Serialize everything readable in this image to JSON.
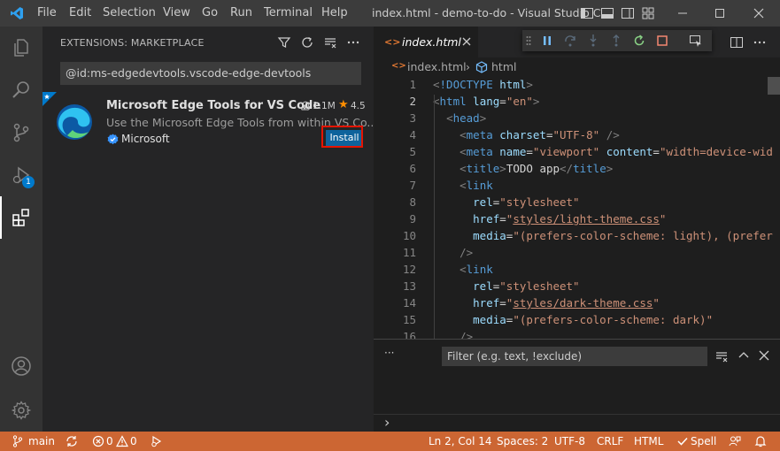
{
  "titlebar": {
    "menus": [
      "File",
      "Edit",
      "Selection",
      "View",
      "Go",
      "Run",
      "Terminal",
      "Help"
    ],
    "window_title": "index.html - demo-to-do - Visual Studio C..."
  },
  "activitybar": {
    "debug_badge": "1"
  },
  "sidebar": {
    "title": "EXTENSIONS: MARKETPLACE",
    "search_value": "@id:ms-edgedevtools.vscode-edge-devtools",
    "extension": {
      "name": "Microsoft Edge Tools for VS Code",
      "downloads": "1.1M",
      "rating": "4.5",
      "description": "Use the Microsoft Edge Tools from within VS Co...",
      "publisher": "Microsoft",
      "install_label": "Install"
    }
  },
  "editor": {
    "tab_label": "index.html",
    "breadcrumb": [
      "index.html",
      "html"
    ],
    "line_numbers": [
      "1",
      "2",
      "3",
      "4",
      "5",
      "6",
      "7",
      "8",
      "9",
      "10",
      "11",
      "12",
      "13",
      "14",
      "15",
      "16"
    ],
    "current_line": "2"
  },
  "panel": {
    "filter_placeholder": "Filter (e.g. text, !exclude)",
    "more_label": "···",
    "prompt": "›"
  },
  "statusbar": {
    "branch": "main",
    "errors": "0",
    "warnings": "0",
    "position": "Ln 2, Col 14",
    "spaces": "Spaces: 2",
    "encoding": "UTF-8",
    "eol": "CRLF",
    "language": "HTML",
    "spell": "Spell"
  },
  "colors": {
    "statusbar": "#cc6633",
    "install_button": "#0e639c",
    "highlight_frame": "#e51400",
    "accent": "#007acc"
  }
}
